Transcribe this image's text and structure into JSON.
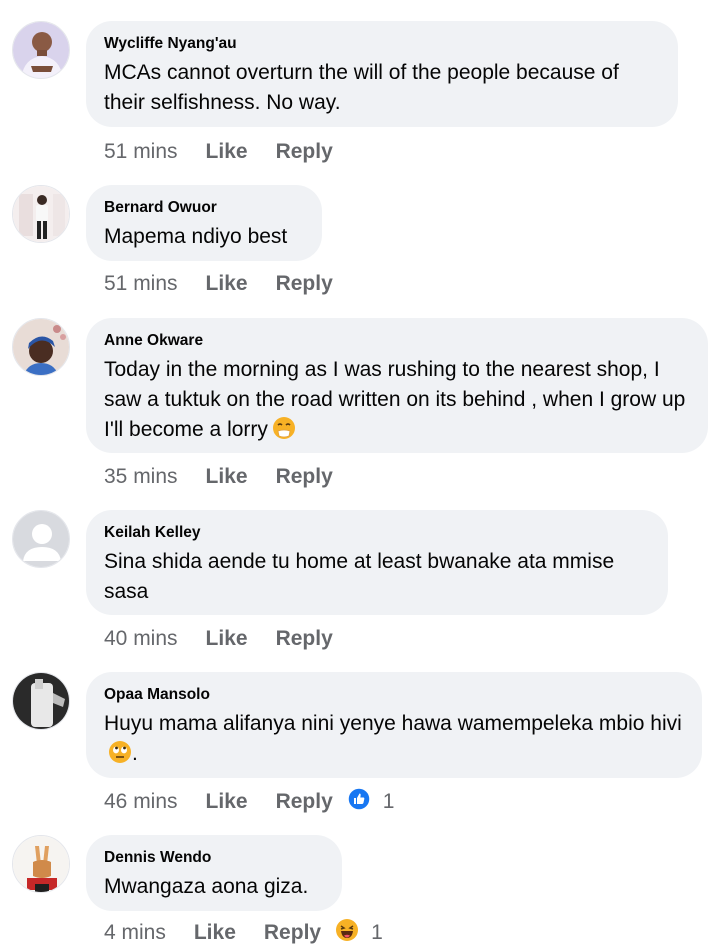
{
  "comments": [
    {
      "author": "Wycliffe Nyang'au",
      "text": "MCAs cannot overturn the will of the people because of their selfishness. No way.",
      "time": "51 mins",
      "like": "Like",
      "reply": "Reply",
      "avatar": "profile-photo"
    },
    {
      "author": "Bernard Owuor",
      "text": "Mapema ndiyo best",
      "time": "51 mins",
      "like": "Like",
      "reply": "Reply",
      "avatar": "profile-photo"
    },
    {
      "author": "Anne Okware",
      "text": "Today in the morning as I was rushing to the nearest shop, I saw a tuktuk on the road written on its  behind , when I grow up I'll become a lorry",
      "emoji": "face-with-hand-over-mouth",
      "time": "35 mins",
      "like": "Like",
      "reply": "Reply",
      "avatar": "profile-photo"
    },
    {
      "author": "Keilah Kelley",
      "text": "Sina shida aende tu home at least bwanake ata mmise sasa",
      "time": "40 mins",
      "like": "Like",
      "reply": "Reply",
      "avatar": "default-avatar"
    },
    {
      "author": "Opaa Mansolo",
      "text": "Huyu mama alifanya nini yenye hawa wamempeleka mbio hivi",
      "emoji": "face-with-rolling-eyes",
      "text_after_emoji": ".",
      "time": "46 mins",
      "like": "Like",
      "reply": "Reply",
      "reaction": {
        "type": "like",
        "count": "1",
        "color": "#1877f2"
      },
      "avatar": "profile-photo"
    },
    {
      "author": "Dennis Wendo",
      "text": "Mwangaza aona giza.",
      "time": "4 mins",
      "like": "Like",
      "reply": "Reply",
      "reaction": {
        "type": "haha",
        "count": "1",
        "color": "#f7b125"
      },
      "avatar": "profile-photo"
    }
  ],
  "colors": {
    "bubble": "#f0f2f5",
    "meta_text": "#65676b",
    "like_blue": "#1877f2",
    "haha_yellow": "#f7b125"
  }
}
